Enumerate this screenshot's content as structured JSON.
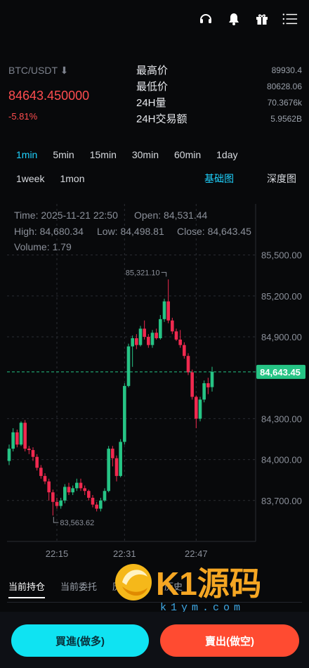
{
  "header": {
    "icons": [
      "headset-icon",
      "notification-icon",
      "gift-icon",
      "menu-icon"
    ]
  },
  "market": {
    "pair": "BTC/USDT",
    "pair_arrow": "⬇",
    "price": "84643.450000",
    "change": "-5.81%",
    "stats": [
      {
        "label": "最高价",
        "value": "89930.4"
      },
      {
        "label": "最低价",
        "value": "80628.06"
      },
      {
        "label": "24H量",
        "value": "70.3676k"
      },
      {
        "label": "24H交易额",
        "value": "5.9562B"
      }
    ]
  },
  "intervals": {
    "row1": [
      "1min",
      "5min",
      "15min",
      "30min",
      "60min",
      "1day"
    ],
    "row2": [
      "1week",
      "1mon"
    ],
    "active": "1min"
  },
  "view_tabs": {
    "basic": "基础图",
    "depth": "深度图"
  },
  "chart_info": {
    "time": "Time: 2025-11-21 22:50",
    "open": "Open: 84,531.44",
    "high": "High: 84,680.34",
    "low": "Low: 84,498.81",
    "close": "Close: 84,643.45",
    "volume": "Volume: 1.79"
  },
  "chart_data": {
    "type": "candlestick",
    "y_ticks": [
      "85,500.00",
      "85,200.00",
      "84,900.00",
      "84,300.00",
      "84,000.00",
      "83,700.00"
    ],
    "ylim": [
      83400,
      85720
    ],
    "x_ticks": [
      "22:15",
      "22:31",
      "22:47"
    ],
    "current_price_label": "84,643.45",
    "current_price": 84643.45,
    "max_label": "85,321.10",
    "min_label": "83,563.62",
    "colors": {
      "up": "#26c485",
      "down": "#f0294f",
      "grid": "#2a2d33",
      "price_line": "#26c485"
    },
    "candles": [
      [
        83990,
        84080,
        83960,
        84110
      ],
      [
        84080,
        84200,
        84060,
        84230
      ],
      [
        84200,
        84110,
        84090,
        84220
      ],
      [
        84110,
        84270,
        84100,
        84280
      ],
      [
        84270,
        84080,
        84060,
        84290
      ],
      [
        84080,
        84070,
        84040,
        84100
      ],
      [
        84070,
        84020,
        83990,
        84090
      ],
      [
        84020,
        83940,
        83920,
        84040
      ],
      [
        83940,
        83880,
        83860,
        83960
      ],
      [
        83880,
        83840,
        83820,
        83900
      ],
      [
        83840,
        83760,
        83700,
        83860
      ],
      [
        83760,
        83690,
        83590,
        83780
      ],
      [
        83690,
        83660,
        83640,
        83720
      ],
      [
        83660,
        83700,
        83640,
        83720
      ],
      [
        83700,
        83800,
        83680,
        83820
      ],
      [
        83800,
        83760,
        83740,
        83830
      ],
      [
        83760,
        83790,
        83740,
        83810
      ],
      [
        83790,
        83830,
        83770,
        83860
      ],
      [
        83830,
        83790,
        83770,
        83860
      ],
      [
        83790,
        83770,
        83740,
        83810
      ],
      [
        83770,
        83720,
        83700,
        83780
      ],
      [
        83720,
        83670,
        83650,
        83740
      ],
      [
        83670,
        83640,
        83620,
        83690
      ],
      [
        83640,
        83700,
        83620,
        83720
      ],
      [
        83700,
        83770,
        83690,
        83790
      ],
      [
        83770,
        84080,
        83760,
        84100
      ],
      [
        84080,
        84010,
        83950,
        84100
      ],
      [
        84010,
        83880,
        83840,
        84030
      ],
      [
        83880,
        84130,
        83870,
        84150
      ],
      [
        84130,
        84540,
        84110,
        84560
      ],
      [
        84540,
        84830,
        84530,
        84850
      ],
      [
        84830,
        84890,
        84680,
        84910
      ],
      [
        84890,
        84840,
        84810,
        84920
      ],
      [
        84840,
        84960,
        84830,
        84980
      ],
      [
        84960,
        84900,
        84880,
        85020
      ],
      [
        84900,
        84840,
        84820,
        84920
      ],
      [
        84840,
        84930,
        84820,
        84950
      ],
      [
        84930,
        84890,
        84880,
        84960
      ],
      [
        84890,
        85030,
        84880,
        85060
      ],
      [
        85030,
        85160,
        85010,
        85180
      ],
      [
        85160,
        85020,
        85000,
        85321.1
      ],
      [
        85020,
        84940,
        84920,
        85040
      ],
      [
        84940,
        84880,
        84870,
        84960
      ],
      [
        84880,
        84840,
        84820,
        84950
      ],
      [
        84840,
        84760,
        84740,
        84860
      ],
      [
        84760,
        84640,
        84620,
        84780
      ],
      [
        84640,
        84460,
        84440,
        84660
      ],
      [
        84460,
        84300,
        84230,
        84470
      ],
      [
        84300,
        84440,
        84280,
        84460
      ],
      [
        84440,
        84560,
        84420,
        84580
      ],
      [
        84560,
        84530,
        84480,
        84600
      ],
      [
        84531.44,
        84643.45,
        84498.81,
        84680.34
      ]
    ]
  },
  "positions_tabs": [
    "当前持仓",
    "当前委托",
    "历史委托",
    "历史"
  ],
  "actions": {
    "buy": "買進(做多)",
    "sell": "賣出(做空)"
  },
  "watermark": {
    "brand": "K1源码",
    "url": "k1ym.com"
  }
}
